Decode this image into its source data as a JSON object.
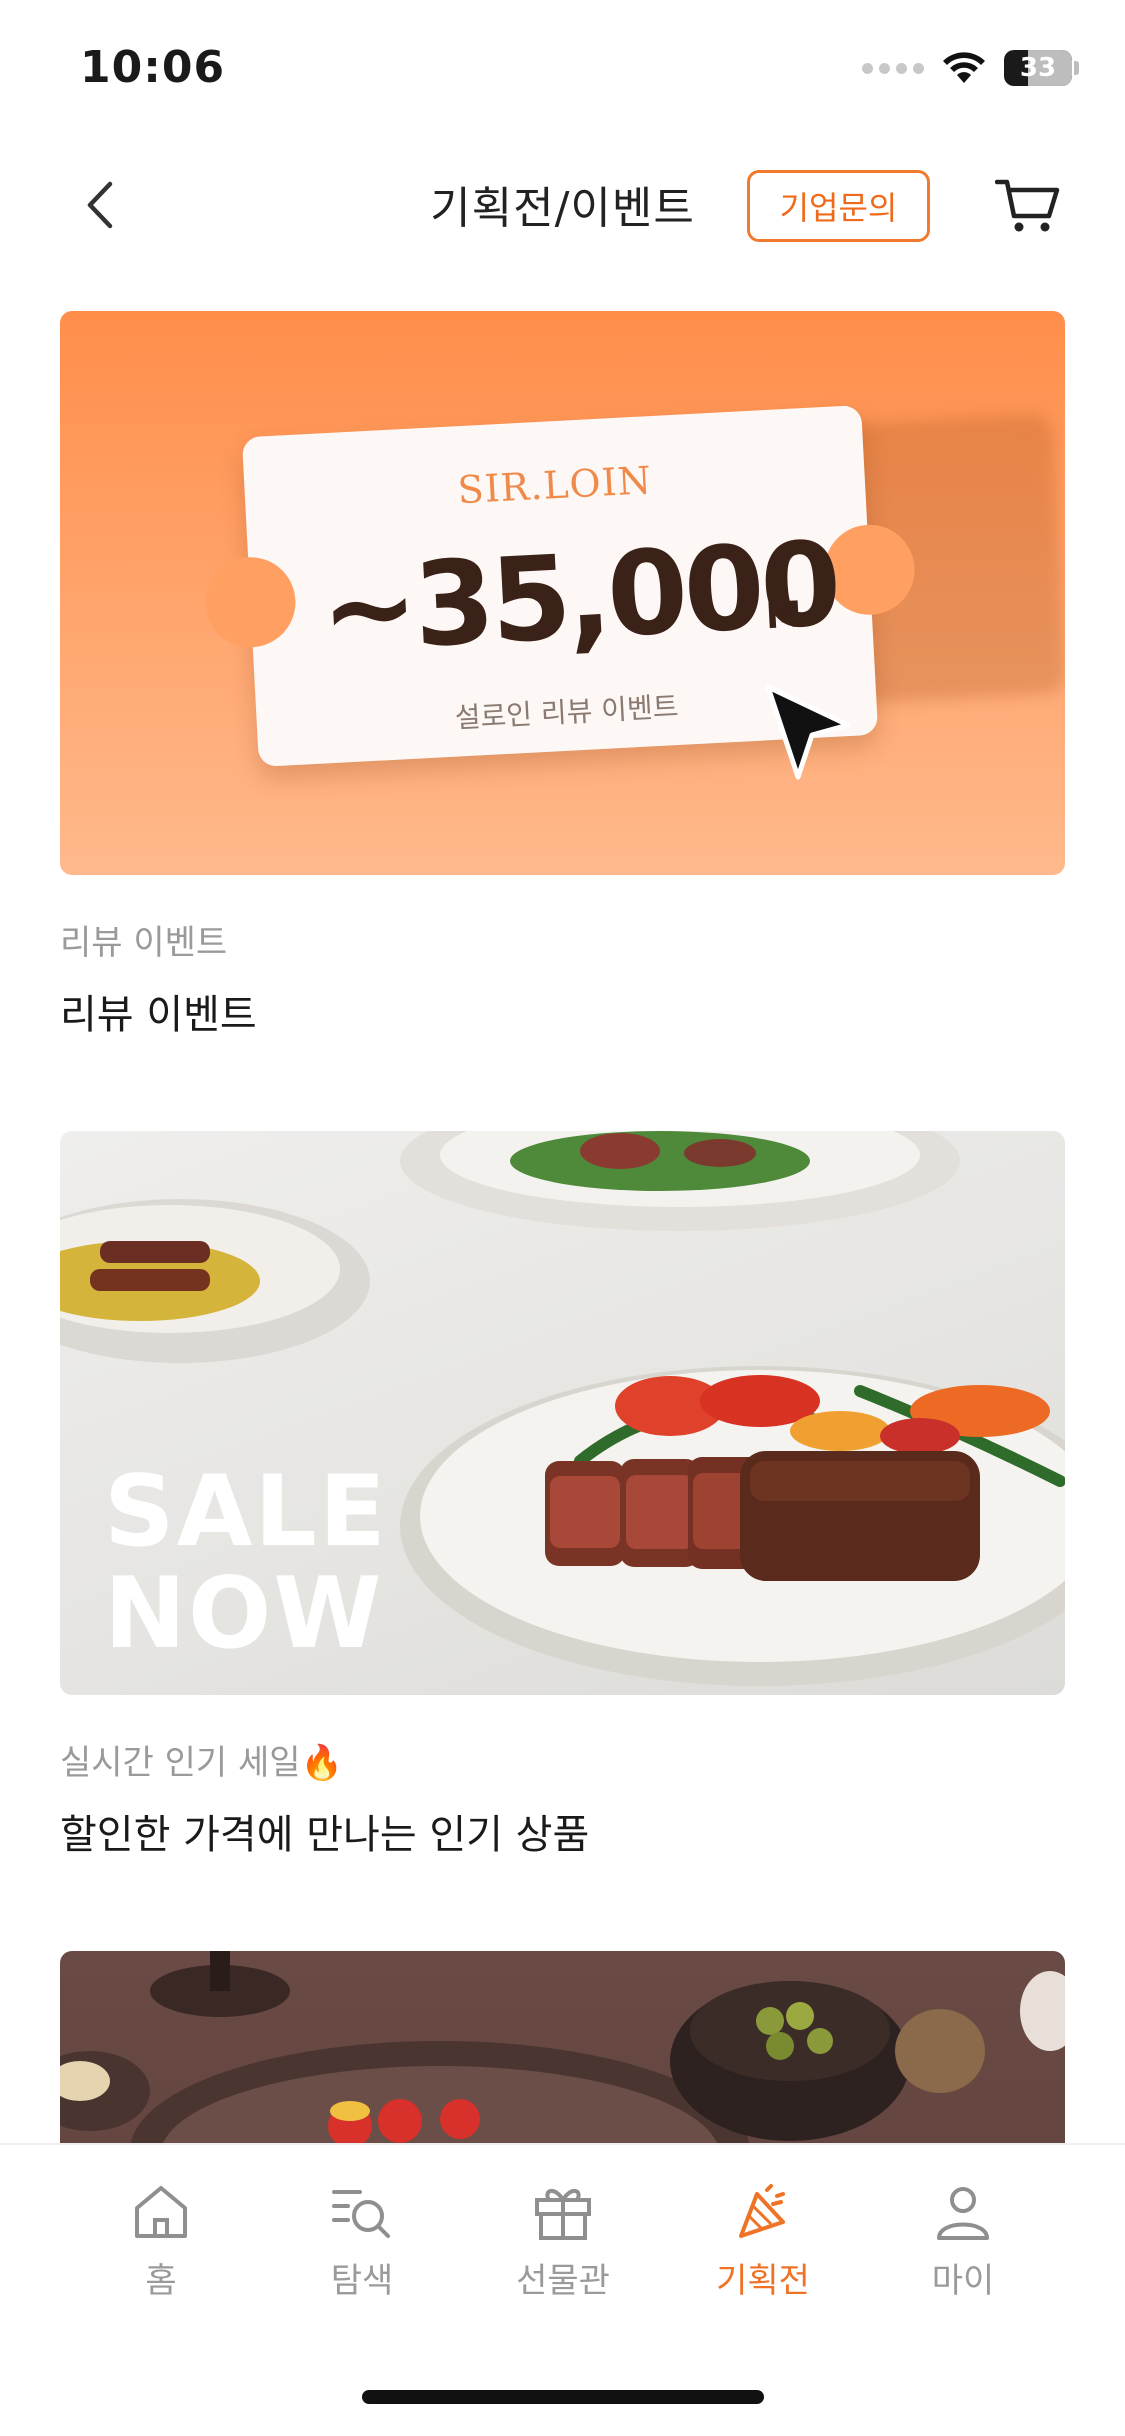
{
  "status_bar": {
    "time": "10:06",
    "battery": "33"
  },
  "header": {
    "title": "기획전/이벤트",
    "business_button": "기업문의",
    "back_icon": "chevron-left-icon",
    "cart_icon": "cart-icon"
  },
  "events": [
    {
      "subtitle": "리뷰 이벤트",
      "title": "리뷰 이벤트",
      "banner": {
        "brand": "SIR.LOIN",
        "amount": "~35,000",
        "unit": "M",
        "caption": "설로인 리뷰 이벤트"
      }
    },
    {
      "subtitle": "실시간 인기 세일🔥",
      "title": "할인한 가격에 만나는 인기 상품",
      "banner": {
        "line1": "SALE",
        "line2": "NOW"
      }
    },
    {
      "subtitle": "",
      "title": ""
    }
  ],
  "bottom_nav": {
    "items": [
      {
        "label": "홈",
        "icon": "home-icon",
        "active": false
      },
      {
        "label": "탐색",
        "icon": "search-list-icon",
        "active": false
      },
      {
        "label": "선물관",
        "icon": "gift-icon",
        "active": false
      },
      {
        "label": "기획전",
        "icon": "party-icon",
        "active": true
      },
      {
        "label": "마이",
        "icon": "person-icon",
        "active": false
      }
    ]
  },
  "colors": {
    "accent": "#ef7327",
    "banner_orange": "#ff8e4a"
  }
}
